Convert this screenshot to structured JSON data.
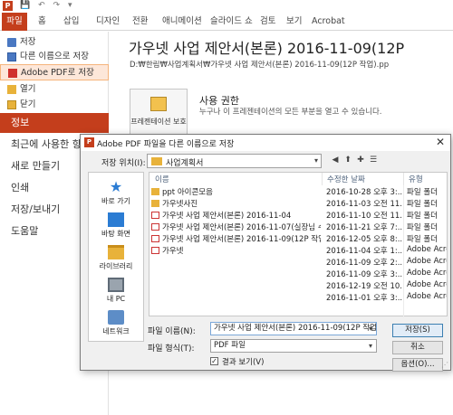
{
  "titlebar": {
    "app_icon": "P",
    "qat": [
      "💾",
      "↶",
      "↷",
      "▾"
    ]
  },
  "ribbon": {
    "tabs": [
      "파일",
      "홈",
      "삽입",
      "디자인",
      "전환",
      "애니메이션",
      "슬라이드 쇼",
      "검토",
      "보기",
      "Acrobat"
    ],
    "active_tab": "파일",
    "accent": "#c43e1c"
  },
  "backstage": {
    "small_items": [
      "저장",
      "다른 이름으로 저장",
      "Adobe PDF로 저장",
      "열기",
      "닫기"
    ],
    "big_items": [
      "정보",
      "최근에 사용한 항목",
      "새로 만들기",
      "인쇄",
      "저장/보내기",
      "도움말"
    ],
    "active_item": "정보"
  },
  "info": {
    "title": "가우넷 사업 제안서(본론) 2016-11-09(12P",
    "path": "D:₩한림₩사업계획서₩가우넷 사업 제안서(본론) 2016-11-09(12P 작업).pp",
    "protect_label": "프레젠테이션 보호",
    "permissions_title": "사용 권한",
    "permissions_desc": "누구나 이 프레젠테이션의 모든 부분을 열고 수 있습니다."
  },
  "dialog": {
    "title": "Adobe PDF 파일을 다른 이름으로 저장",
    "close": "✕",
    "location_label": "저장 위치(I):",
    "location_value": "사업계획서",
    "places": [
      "바로 가기",
      "바탕 화면",
      "라이브러리",
      "내 PC",
      "네트워크"
    ],
    "columns": {
      "name": "이름",
      "date": "수정한 날짜",
      "type": "유형"
    },
    "files": [
      {
        "name": "ppt 아이콘모음",
        "date": "2016-10-28 오후 3:...",
        "type": "파일 폴더",
        "kind": "folder"
      },
      {
        "name": "가우넷사진",
        "date": "2016-11-03 오전 11...",
        "type": "파일 폴더",
        "kind": "folder"
      },
      {
        "name": "가우넷 사업 제안서(본론) 2016-11-04",
        "date": "2016-11-10 오전 11...",
        "type": "파일 폴더",
        "kind": "pdf"
      },
      {
        "name": "가우넷 사업 제안서(본론) 2016-11-07(실장님 수...",
        "date": "2016-11-21 오후 7:...",
        "type": "파일 폴더",
        "kind": "pdf"
      },
      {
        "name": "가우넷 사업 제안서(본론) 2016-11-09(12P 작업)",
        "date": "2016-12-05 오후 8:...",
        "type": "파일 폴더",
        "kind": "pdf"
      },
      {
        "name": "가우넷",
        "date": "2016-11-04 오후 1:...",
        "type": "Adobe Acrobat",
        "kind": "pdf"
      },
      {
        "name": "",
        "date": "2016-11-09 오후 2:...",
        "type": "Adobe Acrobat",
        "kind": "none"
      },
      {
        "name": "",
        "date": "2016-11-09 오후 3:...",
        "type": "Adobe Acrobat",
        "kind": "none"
      },
      {
        "name": "",
        "date": "2016-12-19 오전 10...",
        "type": "Adobe Acrobat",
        "kind": "none"
      },
      {
        "name": "",
        "date": "2016-11-01 오후 3:...",
        "type": "Adobe Acrobat",
        "kind": "none"
      }
    ],
    "filename_label": "파일 이름(N):",
    "filename_value": "가우넷 사업 제안서(본론) 2016-11-09(12P 작업)",
    "filetype_label": "파일 형식(T):",
    "filetype_value": "PDF 파일",
    "view_result_label": "결과 보기(V)",
    "view_result_checked": "✓",
    "save_button": "저장(S)",
    "cancel_button": "취소",
    "options_button": "옵션(O)..."
  }
}
